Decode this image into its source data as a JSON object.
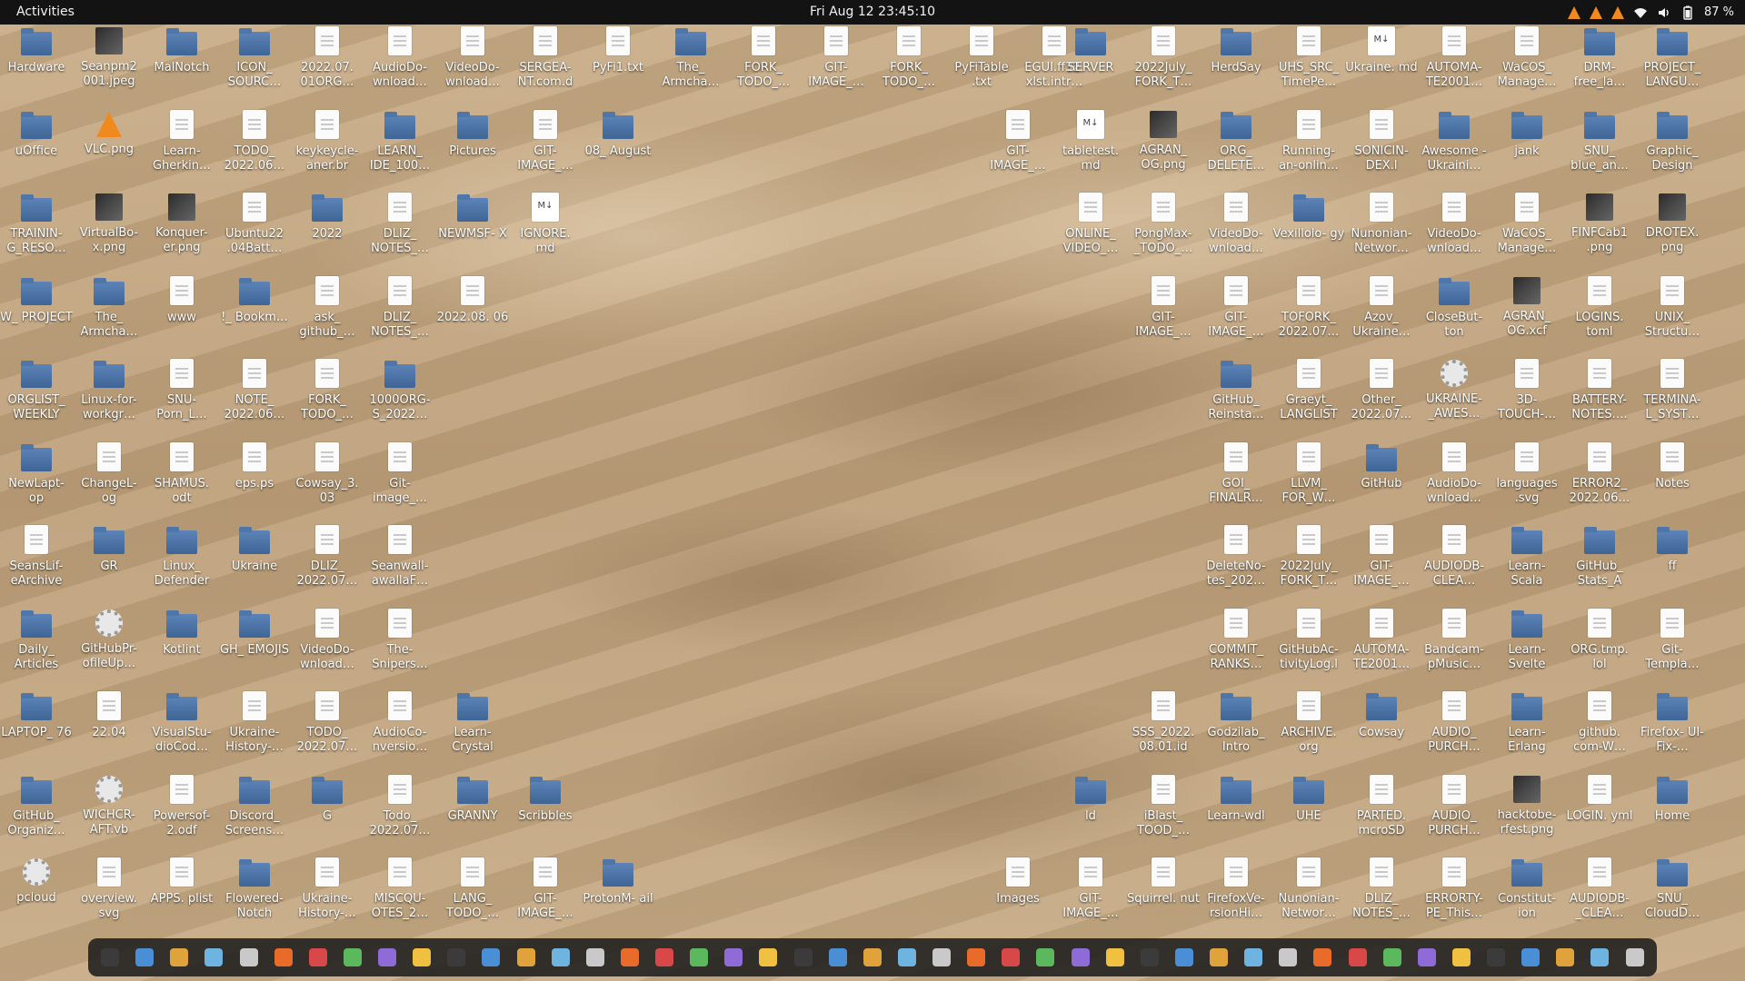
{
  "topbar": {
    "activities": "Activities",
    "clock": "Fri Aug 12  23:45:10",
    "battery": "87 %",
    "tray_icons": [
      "vlc-icon",
      "vlc-icon",
      "vlc-icon",
      "wifi-icon",
      "volume-icon",
      "battery-icon"
    ]
  },
  "desktop_left": [
    [
      "Hardware",
      "Seanpm2 001.jpeg",
      "MalNotch",
      "ICON_ SOURC…",
      "2022.07. 01ORG…",
      "AudioDo- wnload…",
      "VideoDo- wnload…",
      "SERGEA- NT.com.d",
      "PyFi1.txt",
      "The_ Armcha…",
      "FORK_ TODO_…",
      "GIT- IMAGE_…",
      "FORK_ TODO_…",
      "PyFiTable .txt",
      "EGUI.ff32. xlst.intr…"
    ],
    [
      "uOffice",
      "VLC.png",
      "Learn- Gherkin…",
      "TODO_ 2022.06…",
      "keykeycle- aner.br",
      "LEARN_ IDE_100…",
      "Pictures",
      "GIT- IMAGE_…",
      "08_ August"
    ],
    [
      "TRAININ- G_RESO…",
      "VirtualBo- x.png",
      "Konquer- er.png",
      "Ubuntu22 .04Batt…",
      "2022",
      "DLIZ_ NOTES_…",
      "NEWMSF- X",
      "IGNORE. md"
    ],
    [
      "W_ PROJECT",
      "The_ Armcha…",
      "www",
      "!_ Bookm…",
      "ask_ github_…",
      "DLIZ_ NOTES_…",
      "2022.08. 06"
    ],
    [
      "ORGLIST_ WEEKLY",
      "Linux-for- workgr…",
      "SNU- Porn_L…",
      "NOTE_ 2022.06…",
      "FORK_ TODO_…",
      "1000ORG- S_2022…"
    ],
    [
      "NewLapt- op",
      "ChangeL- og",
      "SHAMUS. odt",
      "eps.ps",
      "Cowsay_3. 03",
      "Git- image_…"
    ],
    [
      "SeansLif- eArchive",
      "GR",
      "Linux_ Defender",
      "Ukraine",
      "DLIZ_ 2022.07…",
      "Seanwall- awallaF…"
    ],
    [
      "Daily_ Articles",
      "GitHubPr- ofileUp…",
      "Kotlint",
      "GH_ EMOJIS",
      "VideoDo- wnload…",
      "The- Snipers…"
    ],
    [
      "LAPTOP_ 76",
      "22.04",
      "VisualStu- dioCod…",
      "Ukraine- History-…",
      "TODO_ 2022.07…",
      "AudioCo- nversio…",
      "Learn- Crystal"
    ],
    [
      "GitHub_ Organiz…",
      "WICHCR- AFT.vb",
      "Powersof- 2.odf",
      "Discord_ Screens…",
      "G",
      "Todo_ 2022.07…",
      "GRANNY",
      "Scribbles"
    ],
    [
      "pcloud",
      "overview. svg",
      "APPS. plist",
      "Flowered- Notch",
      "Ukraine- History-…",
      "MISCQU- OTES_2…",
      "LANG_ TODO_…",
      "GIT- IMAGE_…",
      "ProtonM- ail"
    ]
  ],
  "desktop_right": [
    [
      "SERVER",
      "2022July_ FORK_T…",
      "HerdSay",
      "UHS_SRC_ TimePe…",
      "Ukraine. md",
      "AUTOMA- TE2001…",
      "WaCOS_ Manage…",
      "DRM- free_la…",
      "PROJECT_ LANGU…"
    ],
    [
      "GIT- IMAGE_…",
      "tabletest. md",
      "AGRAN_ OG.png",
      "ORG_ DELETE…",
      "Running- an-onlin…",
      "SONICIN- DEX.l",
      "Awesome -Ukraini…",
      "jank",
      "SNU_ blue_an…",
      "Graphic_ Design"
    ],
    [
      "ONLINE_ VIDEO_…",
      "PongMax- _TODO_…",
      "VideoDo- wnload…",
      "Vexillolo- gy",
      "Nunonian- Networ…",
      "VideoDo- wnload…",
      "WaCOS_ Manage…",
      "FINFCab1 .png",
      "DROTEX. png"
    ],
    [
      "GIT- IMAGE_…",
      "GIT- IMAGE_…",
      "TOFORK_ 2022.07…",
      "Azov_ Ukraine…",
      "CloseBut- ton",
      "AGRAN_ OG.xcf",
      "LOGINS. toml",
      "UNIX_ Structu…"
    ],
    [
      "GitHub_ Reinsta…",
      "Graeyt_ LANGLIST",
      "Other_ 2022.07…",
      "UKRAINE- _AWES…",
      "3D- TOUCH-…",
      "BATTERY- NOTES.…",
      "TERMINA- L_SYST…"
    ],
    [
      "GOI_ FINALR…",
      "LLVM_ FOR_W…",
      "GitHub",
      "AudioDo- wnload…",
      "languages .svg",
      "ERROR2_ 2022.06…",
      "Notes"
    ],
    [
      "DeleteNo- tes_202…",
      "2022July_ FORK_T…",
      "GIT- IMAGE_…",
      "AUDIODB- CLEA…",
      "Learn- Scala",
      "GitHub_ Stats_A",
      "ff"
    ],
    [
      "COMMIT_ RANKS…",
      "GitHubAc- tivityLog.l",
      "AUTOMA- TE2001…",
      "Bandcam- pMusic…",
      "Learn- Svelte",
      "ORG.tmp. lol",
      "Git- Templa…"
    ],
    [
      "SSS_2022. 08.01.id",
      "Godzilab_ Intro",
      "ARCHIVE. org",
      "Cowsay",
      "AUDIO_ PURCH…",
      "Learn- Erlang",
      "github. com-W…",
      "Firefox- UI-Fix-…"
    ],
    [
      "ld",
      "iBlast_ TOOD_…",
      "Learn-wdl",
      "UHE",
      "PARTED. mcroSD",
      "AUDIO_ PURCH…",
      "hacktobe- rfest.png",
      "LOGIN. yml",
      "Home"
    ],
    [
      "Images",
      "GIT- IMAGE_…",
      "Squirrel. nut",
      "FirefoxVe- rsionHi…",
      "Nunonian- Networ…",
      "DLIZ_ NOTES_…",
      "ERRORTY- PE_This…",
      "Constitut- ion",
      "AUDIODB- _CLEA…",
      "SNU_ CloudD…"
    ]
  ],
  "dock_items": [
    "terminal",
    "files",
    "chrome",
    "text-editor",
    "archive",
    "search",
    "document",
    "notes",
    "terminal-2",
    "firefox",
    "vlc",
    "circle",
    "software",
    "editor",
    "writer",
    "help",
    "monitor",
    "obs",
    "tux",
    "steam",
    "virtualbox",
    "screenshot",
    "calc",
    "impress",
    "draw",
    "base",
    "discord",
    "telegram",
    "kdenlive",
    "pdf",
    "math",
    "rec",
    "gimp",
    "code",
    "inkscape",
    "writer-2",
    "settings",
    "photo",
    "media",
    "art",
    "chat",
    "bluetooth",
    "network",
    "disk",
    "apps"
  ]
}
